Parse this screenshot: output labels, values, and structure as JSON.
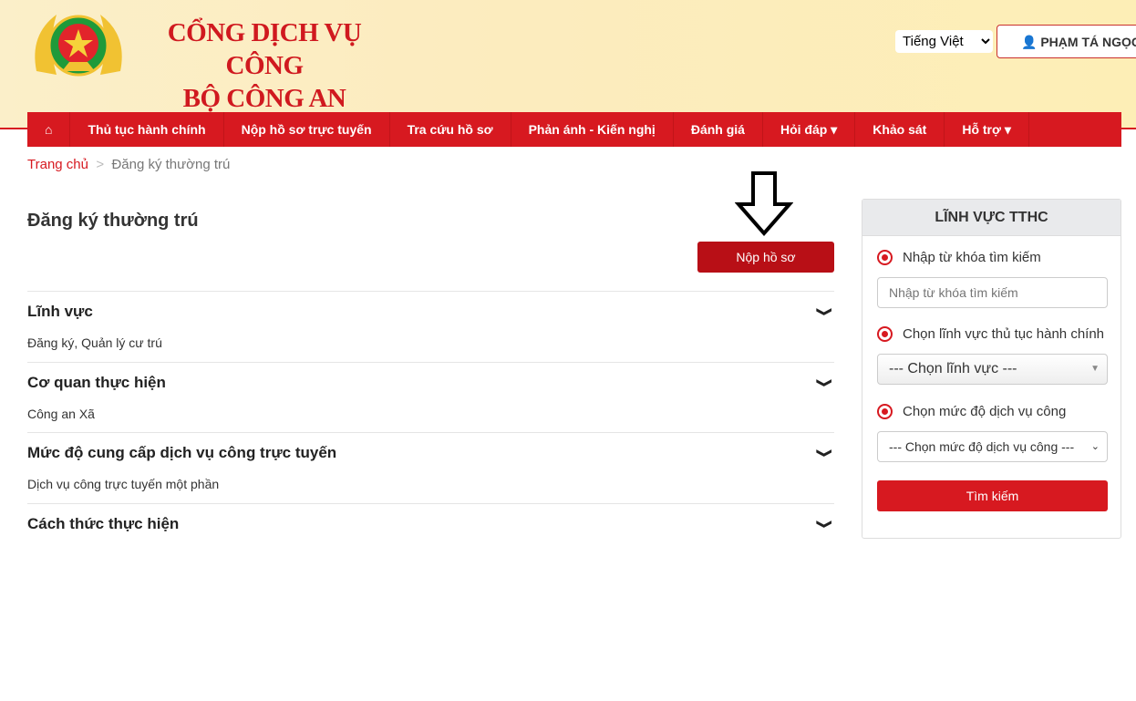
{
  "header": {
    "title_line1": "CỔNG DỊCH VỤ CÔNG",
    "title_line2": "BỘ CÔNG AN",
    "language": "Tiếng Việt",
    "user": "PHẠM TÁ NGỌC"
  },
  "nav": [
    {
      "label": "Thủ tục hành chính"
    },
    {
      "label": "Nộp hồ sơ trực tuyến"
    },
    {
      "label": "Tra cứu hồ sơ"
    },
    {
      "label": "Phản ánh - Kiến nghị"
    },
    {
      "label": "Đánh giá"
    },
    {
      "label": "Hỏi đáp ▾"
    },
    {
      "label": "Khảo sát"
    },
    {
      "label": "Hỗ trợ ▾"
    }
  ],
  "breadcrumb": {
    "home": "Trang chủ",
    "sep": ">",
    "current": "Đăng ký thường trú"
  },
  "main": {
    "title": "Đăng ký thường trú",
    "submit": "Nộp hồ sơ",
    "sections": [
      {
        "title": "Lĩnh vực",
        "value": "Đăng ký, Quản lý cư trú"
      },
      {
        "title": "Cơ quan thực hiện",
        "value": "Công an Xã"
      },
      {
        "title": "Mức độ cung cấp dịch vụ công trực tuyến",
        "value": "Dịch vụ công trực tuyến một phần"
      },
      {
        "title": "Cách thức thực hiện",
        "value": ""
      }
    ]
  },
  "panel": {
    "title": "LĨNH VỰC TTHC",
    "keyword_label": "Nhập từ khóa tìm kiếm",
    "keyword_placeholder": "Nhập từ khóa tìm kiếm",
    "field_label": "Chọn lĩnh vực thủ tục hành chính",
    "field_value": "--- Chọn lĩnh vực ---",
    "level_label": "Chọn mức độ dịch vụ công",
    "level_value": "--- Chọn mức độ dịch vụ công ---",
    "search": "Tìm kiếm"
  },
  "colors": {
    "brand": "#d71920"
  }
}
